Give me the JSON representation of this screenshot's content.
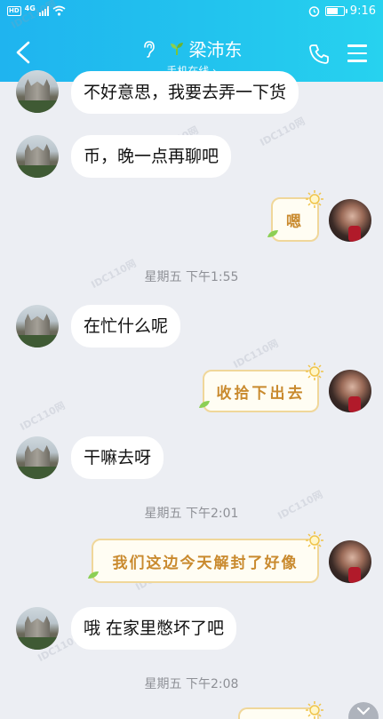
{
  "status_bar": {
    "network_tag": "HD",
    "network_type": "4G",
    "time": "9:16"
  },
  "header": {
    "contact_name": "梁沛东",
    "subtitle": "手机在线 ›"
  },
  "messages": [
    {
      "side": "left",
      "text": "不好意思，我要去弄一下货"
    },
    {
      "side": "left",
      "text": "币，晚一点再聊吧"
    },
    {
      "side": "right",
      "text": "嗯"
    },
    {
      "side": "center",
      "text": "星期五 下午1:55"
    },
    {
      "side": "left",
      "text": "在忙什么呢"
    },
    {
      "side": "right",
      "text": "收拾下出去"
    },
    {
      "side": "left",
      "text": "干嘛去呀"
    },
    {
      "side": "center",
      "text": "星期五 下午2:01"
    },
    {
      "side": "right",
      "text": "我们这边今天解封了好像"
    },
    {
      "side": "left",
      "text": "哦 在家里憋坏了吧"
    },
    {
      "side": "center",
      "text": "星期五 下午2:08"
    }
  ],
  "watermark": "IDC110网",
  "colors": {
    "header_start": "#1fb4ef",
    "header_end": "#27d2ef",
    "chat_bg": "#eceef3",
    "deco_text": "#c98a2e"
  }
}
